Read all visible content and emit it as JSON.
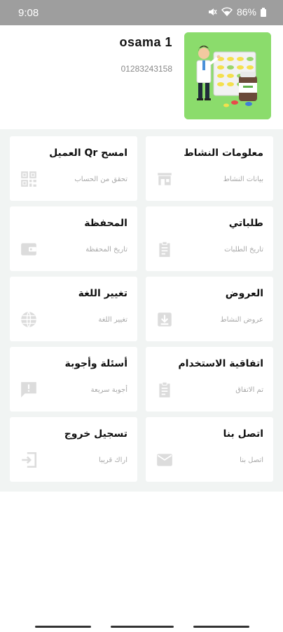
{
  "status": {
    "time": "9:08",
    "battery": "86%"
  },
  "profile": {
    "name": "osama 1",
    "phone": "01283243158"
  },
  "menu": [
    {
      "title": "معلومات النشاط",
      "subtitle": "بيانات النشاط",
      "icon": "store-icon"
    },
    {
      "title": "امسح Qr العميل",
      "subtitle": "تحقق من الحساب",
      "icon": "qr-code-icon"
    },
    {
      "title": "طلباتي",
      "subtitle": "تاريخ الطلبات",
      "icon": "clipboard-icon"
    },
    {
      "title": "المحفظة",
      "subtitle": "تاريخ المحفظة",
      "icon": "wallet-icon"
    },
    {
      "title": "العروض",
      "subtitle": "عروض النشاط",
      "icon": "offer-download-icon"
    },
    {
      "title": "تغيير اللغة",
      "subtitle": "تغيير اللغة",
      "icon": "globe-icon"
    },
    {
      "title": "اتفاقية الاستخدام",
      "subtitle": "تم الاتفاق",
      "icon": "clipboard-check-icon"
    },
    {
      "title": "أسئلة وأجوبة",
      "subtitle": "أجوبة سريعة",
      "icon": "feedback-icon"
    },
    {
      "title": "اتصل بنا",
      "subtitle": "اتصل بنا",
      "icon": "mail-icon"
    },
    {
      "title": "تسجيل خروج",
      "subtitle": "اراك قريبا",
      "icon": "logout-icon"
    }
  ],
  "colors": {
    "avatar_bg": "#8bdc6c",
    "grid_bg": "#f1f4f3",
    "icon": "#dcdcdc"
  }
}
